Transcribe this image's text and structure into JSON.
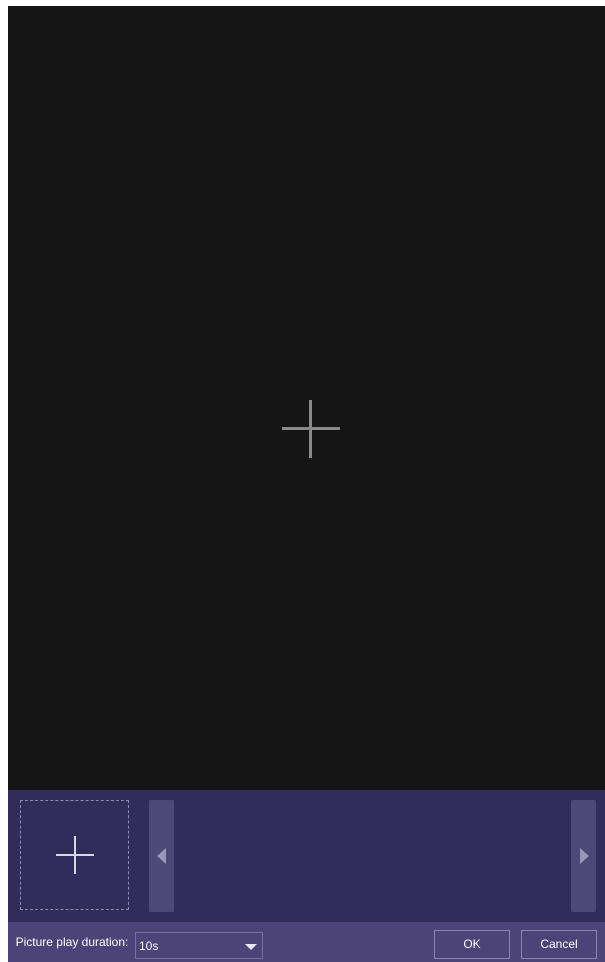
{
  "footer": {
    "duration_label": "Picture play duration:",
    "duration_value": "10s",
    "ok_label": "OK",
    "cancel_label": "Cancel"
  },
  "icons": {
    "preview_add": "plus-icon",
    "slot_add": "plus-icon",
    "scroll_left": "triangle-left-icon",
    "scroll_right": "triangle-right-icon",
    "dropdown": "triangle-down-icon"
  },
  "colors": {
    "preview_background": "#151515",
    "strip_background": "#312c59",
    "footer_background": "#4c4478",
    "scroll_button": "#4d4875",
    "text": "#ffffff"
  }
}
